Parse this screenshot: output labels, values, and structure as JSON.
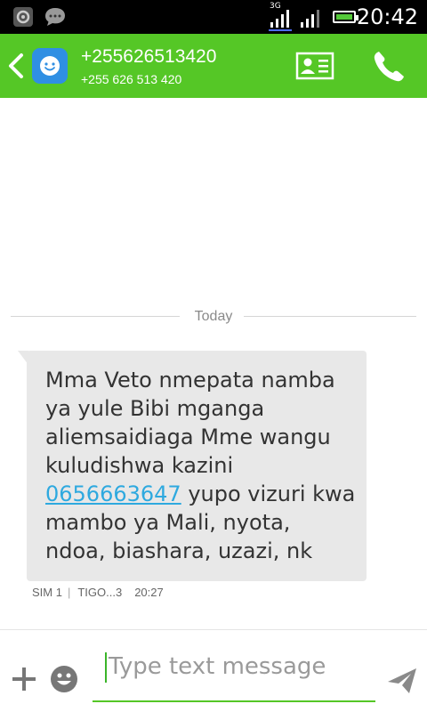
{
  "status_bar": {
    "network_type": "3G",
    "time": "20:42",
    "left_icons": [
      "settings-icon",
      "chat-bubble-icon"
    ],
    "battery_color": "#55c93a"
  },
  "header": {
    "background": "#55c726",
    "contact_number": "+255626513420",
    "contact_number_formatted": "+255 626 513 420",
    "icons": [
      "back-arrow-icon",
      "messenger-avatar-icon",
      "contact-card-icon",
      "phone-icon"
    ]
  },
  "conversation": {
    "date_divider": "Today",
    "message": {
      "text_before": "Mma Veto nmepata namba ya yule Bibi mganga aliemsaidiaga Mme wangu kuludishwa kazini ",
      "phone_link": "0656663647",
      "text_after": " yupo vizuri kwa mambo ya Mali, nyota, ndoa, biashara, uzazi, nk",
      "sim": "SIM 1",
      "carrier": "TIGO...3",
      "time": "20:27"
    }
  },
  "composer": {
    "placeholder": "Type text message",
    "icons": [
      "add-icon",
      "emoji-icon",
      "send-icon"
    ],
    "accent": "#55c726"
  }
}
